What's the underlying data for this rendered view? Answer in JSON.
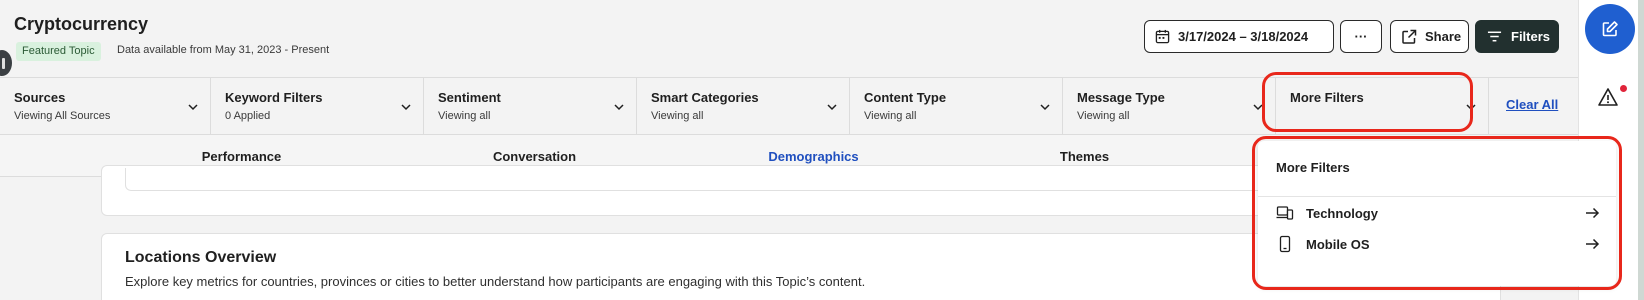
{
  "header": {
    "title": "Cryptocurrency",
    "featured_badge": "Featured Topic",
    "availability": "Data available from May 31, 2023 - Present",
    "date_range": "3/17/2024 – 3/18/2024",
    "more_label": "···",
    "share_label": "Share",
    "filters_label": "Filters"
  },
  "filters": [
    {
      "name": "Sources",
      "value": "Viewing All Sources"
    },
    {
      "name": "Keyword Filters",
      "value": "0 Applied"
    },
    {
      "name": "Sentiment",
      "value": "Viewing all"
    },
    {
      "name": "Smart Categories",
      "value": "Viewing all"
    },
    {
      "name": "Content Type",
      "value": "Viewing all"
    },
    {
      "name": "Message Type",
      "value": "Viewing all"
    },
    {
      "name": "More Filters",
      "value": ""
    }
  ],
  "clear_all": "Clear All",
  "tabs": [
    {
      "label": "Performance"
    },
    {
      "label": "Conversation"
    },
    {
      "label": "Demographics",
      "active": true
    },
    {
      "label": "Themes"
    }
  ],
  "locations": {
    "title": "Locations Overview",
    "subtitle": "Explore key metrics for countries, provinces or cities to better understand how participants are engaging with this Topic’s content."
  },
  "more_filters_panel": {
    "title": "More Filters",
    "items": [
      {
        "label": "Technology",
        "icon": "devices-icon"
      },
      {
        "label": "Mobile OS",
        "icon": "mobile-phone-icon"
      }
    ]
  },
  "colors": {
    "accent": "#1f4fbf",
    "primary_button": "#22302f",
    "highlight": "#e8271b",
    "compose": "#1f5fd0",
    "featured_bg": "#d9f1de"
  }
}
